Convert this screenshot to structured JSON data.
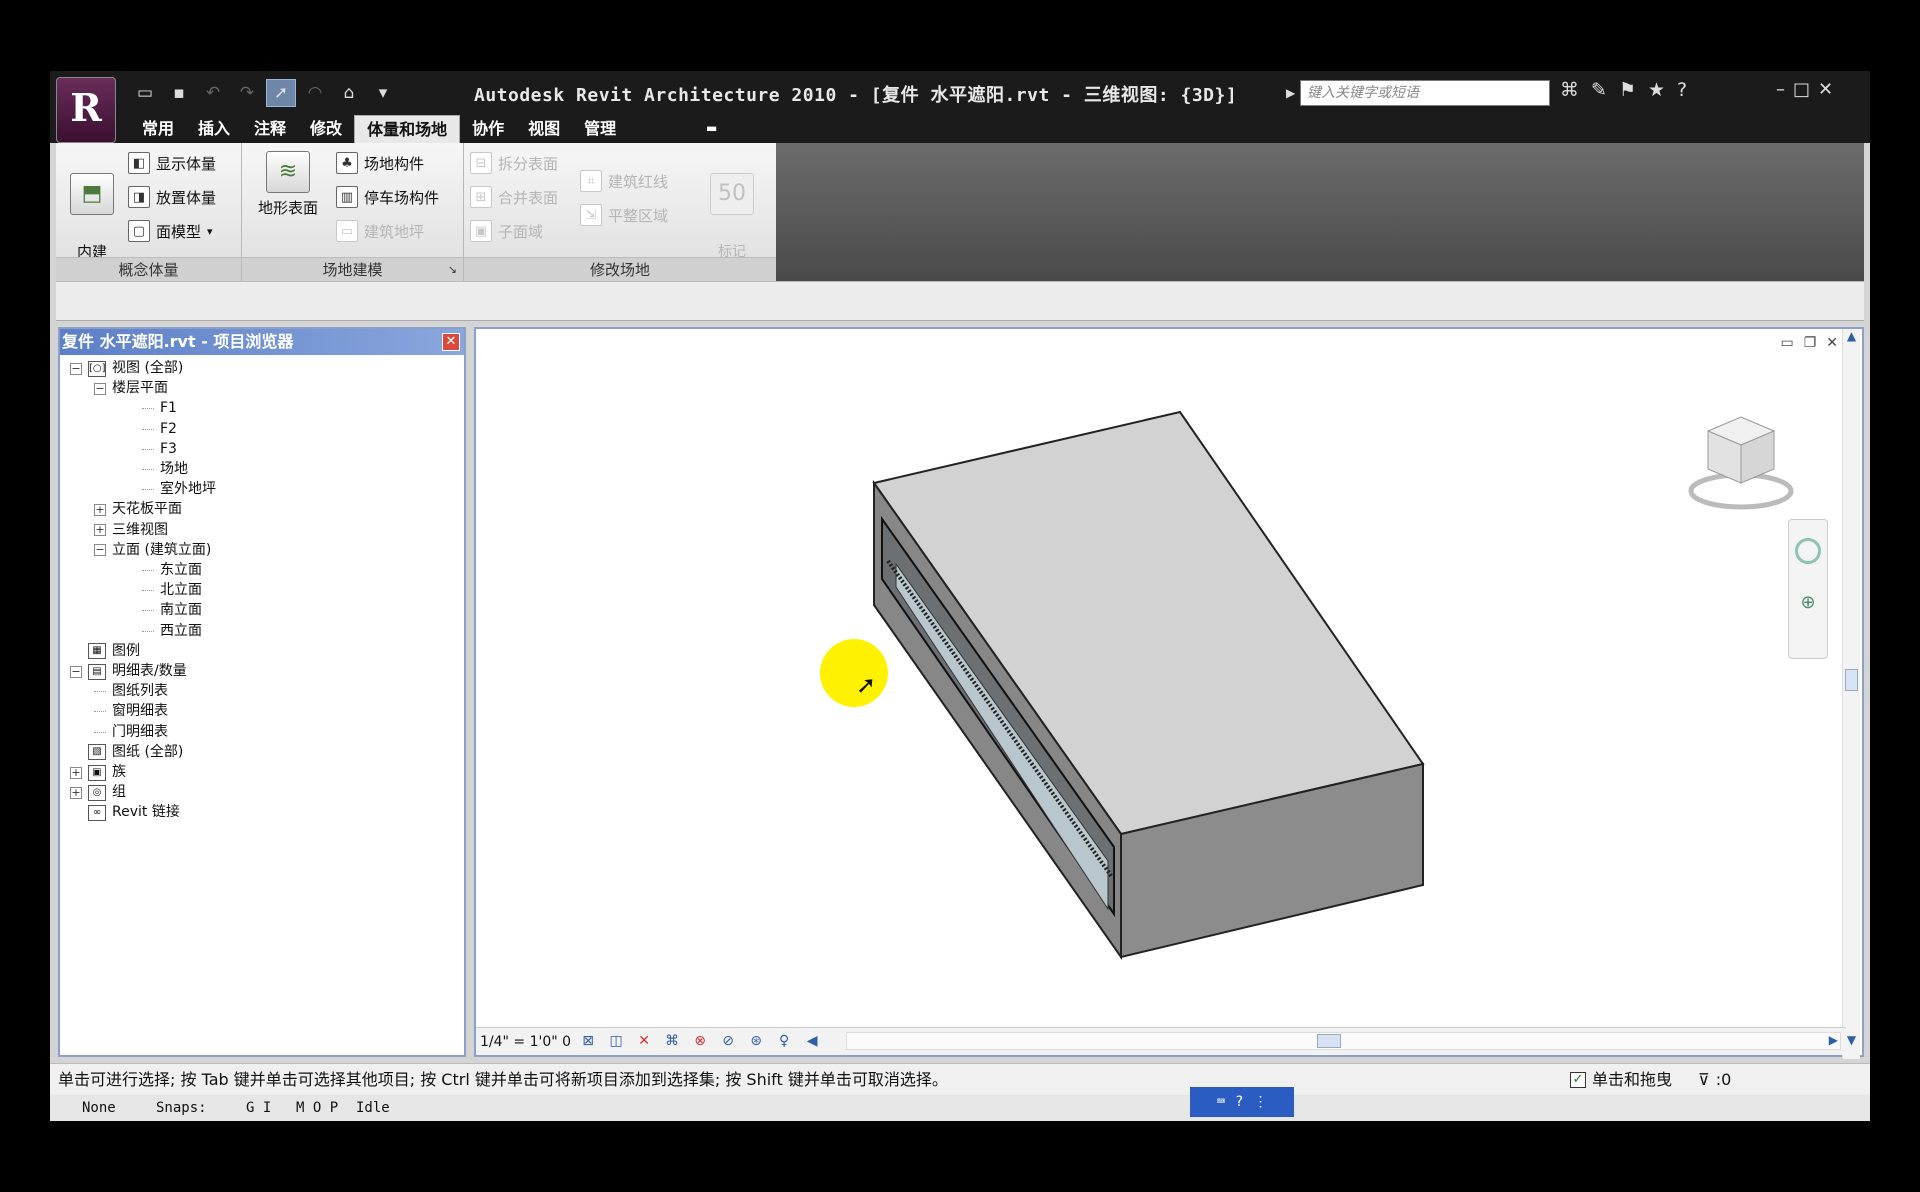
{
  "window": {
    "title": "Autodesk Revit Architecture 2010 - [复件 水平遮阳.rvt - 三维视图: {3D}]",
    "search_placeholder": "键入关键字或短语",
    "app_button_letter": "R"
  },
  "tabs": [
    "常用",
    "插入",
    "注释",
    "修改",
    "体量和场地",
    "协作",
    "视图",
    "管理"
  ],
  "active_tab": "体量和场地",
  "ribbon": {
    "massing": {
      "label": "概念体量",
      "inplace": "内建\n体量",
      "show_mass": "显示体量",
      "place_mass": "放置体量",
      "face_model": "面模型"
    },
    "site_model": {
      "label": "场地建模",
      "toposurface": "地形表面",
      "site_component": "场地构件",
      "parking_component": "停车场构件",
      "building_pad": "建筑地坪"
    },
    "modify_site": {
      "label": "修改场地",
      "split_surface": "拆分表面",
      "merge_surfaces": "合并表面",
      "subregion": "子面域",
      "property_line": "建筑红线",
      "graded_region": "平整区域",
      "label_contours": "标记\n等高线"
    }
  },
  "browser": {
    "title": "复件 水平遮阳.rvt - 项目浏览器",
    "nodes": [
      {
        "text": "视图 (全部)",
        "level": 0,
        "exp": "−",
        "icon": "[○]"
      },
      {
        "text": "楼层平面",
        "level": 1,
        "exp": "−"
      },
      {
        "text": "F1",
        "level": 2
      },
      {
        "text": "F2",
        "level": 2
      },
      {
        "text": "F3",
        "level": 2
      },
      {
        "text": "场地",
        "level": 2
      },
      {
        "text": "室外地坪",
        "level": 2
      },
      {
        "text": "天花板平面",
        "level": 1,
        "exp": "+"
      },
      {
        "text": "三维视图",
        "level": 1,
        "exp": "+"
      },
      {
        "text": "立面 (建筑立面)",
        "level": 1,
        "exp": "−"
      },
      {
        "text": "东立面",
        "level": 2
      },
      {
        "text": "北立面",
        "level": 2
      },
      {
        "text": "南立面",
        "level": 2
      },
      {
        "text": "西立面",
        "level": 2
      },
      {
        "text": "图例",
        "level": 0,
        "icon": "▦"
      },
      {
        "text": "明细表/数量",
        "level": 0,
        "exp": "−",
        "icon": "▤"
      },
      {
        "text": "图纸列表",
        "level": 1
      },
      {
        "text": "窗明细表",
        "level": 1
      },
      {
        "text": "门明细表",
        "level": 1
      },
      {
        "text": "图纸 (全部)",
        "level": 0,
        "icon": "▧"
      },
      {
        "text": "族",
        "level": 0,
        "exp": "+",
        "icon": "▣"
      },
      {
        "text": "组",
        "level": 0,
        "exp": "+",
        "icon": "◎"
      },
      {
        "text": "Revit 链接",
        "level": 0,
        "icon": "∞"
      }
    ]
  },
  "view": {
    "scale": "1/4\" = 1'0\"",
    "scale_suffix": "0"
  },
  "status": {
    "message": "单击可进行选择; 按 Tab 键并单击可选择其他项目; 按 Ctrl 键并单击可将新项目添加到选择集; 按 Shift 键并单击可取消选择。",
    "drag_label": "单击和拖曳",
    "filter_count": ":0"
  },
  "bottom": {
    "none": "None",
    "snaps": "Snaps:",
    "gi": "G I",
    "mop": "M O P",
    "idle": "Idle"
  },
  "colors": {
    "title_bg": "#1b1b1b",
    "browser_title": "#5c7fc7",
    "highlight": "#fff200"
  }
}
